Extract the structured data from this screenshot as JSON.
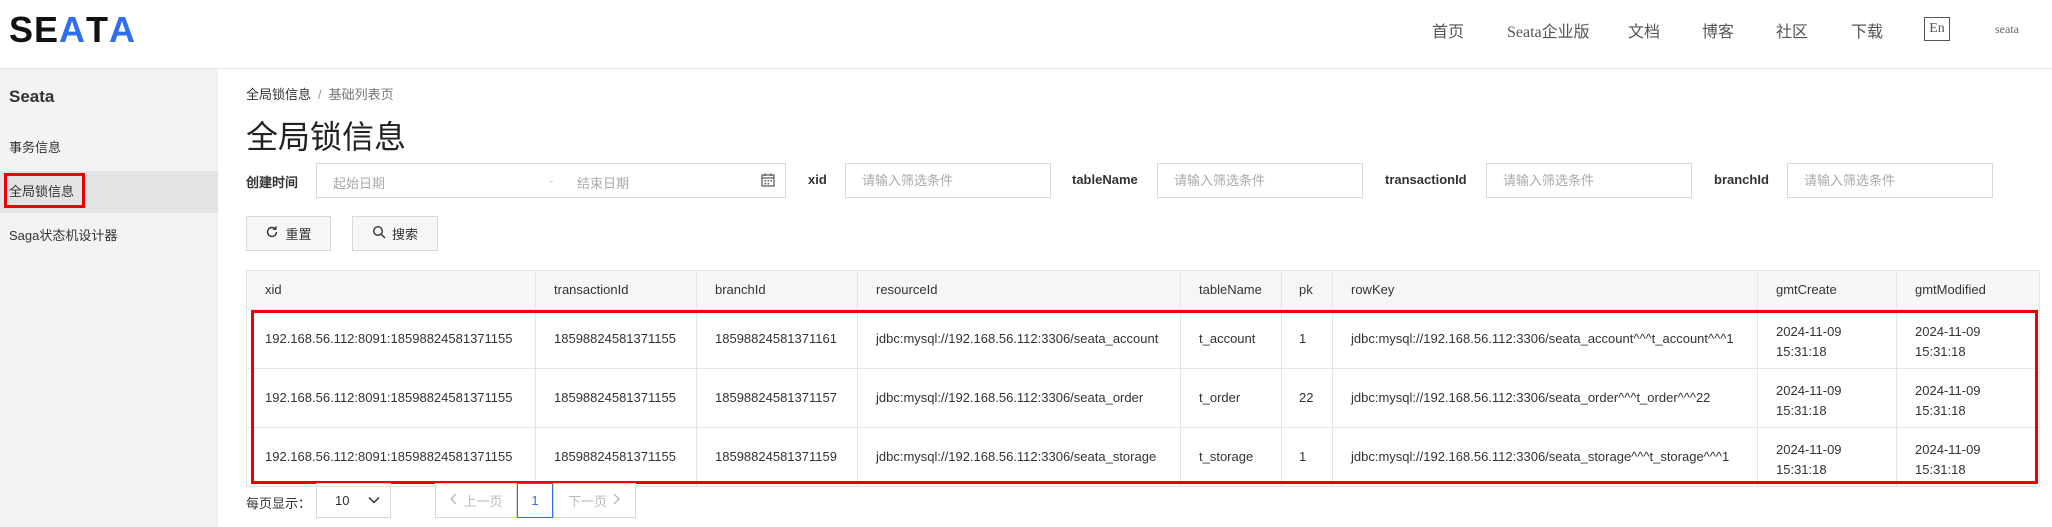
{
  "header": {
    "logo": {
      "s": "S",
      "e": "E",
      "a": "A",
      "t": "T",
      "a2": "A"
    },
    "nav": [
      "首页",
      "Seata企业版",
      "文档",
      "博客",
      "社区",
      "下载"
    ],
    "lang": "En",
    "user": "seata"
  },
  "sidebar": {
    "title": "Seata",
    "items": [
      {
        "label": "事务信息"
      },
      {
        "label": "全局锁信息"
      },
      {
        "label": "Saga状态机设计器"
      }
    ]
  },
  "breadcrumb": {
    "item1": "全局锁信息",
    "sep": "/",
    "item2": "基础列表页"
  },
  "page_title": "全局锁信息",
  "filters": {
    "created_label": "创建时间",
    "start_placeholder": "起始日期",
    "range_sep": "-",
    "end_placeholder": "结束日期",
    "xid_label": "xid",
    "tablename_label": "tableName",
    "transactionid_label": "transactionId",
    "branchid_label": "branchId",
    "input_placeholder": "请输入筛选条件"
  },
  "buttons": {
    "reset": "重置",
    "search": "搜索"
  },
  "table": {
    "columns": [
      "xid",
      "transactionId",
      "branchId",
      "resourceId",
      "tableName",
      "pk",
      "rowKey",
      "gmtCreate",
      "gmtModified"
    ],
    "rows": [
      {
        "xid": "192.168.56.112:8091:18598824581371155",
        "transactionId": "18598824581371155",
        "branchId": "18598824581371161",
        "resourceId": "jdbc:mysql://192.168.56.112:3306/seata_account",
        "tableName": "t_account",
        "pk": "1",
        "rowKey": "jdbc:mysql://192.168.56.112:3306/seata_account^^^t_account^^^1",
        "gmtCreate": [
          "2024-11-09",
          "15:31:18"
        ],
        "gmtModified": [
          "2024-11-09",
          "15:31:18"
        ]
      },
      {
        "xid": "192.168.56.112:8091:18598824581371155",
        "transactionId": "18598824581371155",
        "branchId": "18598824581371157",
        "resourceId": "jdbc:mysql://192.168.56.112:3306/seata_order",
        "tableName": "t_order",
        "pk": "22",
        "rowKey": "jdbc:mysql://192.168.56.112:3306/seata_order^^^t_order^^^22",
        "gmtCreate": [
          "2024-11-09",
          "15:31:18"
        ],
        "gmtModified": [
          "2024-11-09",
          "15:31:18"
        ]
      },
      {
        "xid": "192.168.56.112:8091:18598824581371155",
        "transactionId": "18598824581371155",
        "branchId": "18598824581371159",
        "resourceId": "jdbc:mysql://192.168.56.112:3306/seata_storage",
        "tableName": "t_storage",
        "pk": "1",
        "rowKey": "jdbc:mysql://192.168.56.112:3306/seata_storage^^^t_storage^^^1",
        "gmtCreate": [
          "2024-11-09",
          "15:31:18"
        ],
        "gmtModified": [
          "2024-11-09",
          "15:31:18"
        ]
      }
    ]
  },
  "pagination": {
    "per_page_label": "每页显示：",
    "per_page_value": "10",
    "prev": "上一页",
    "current": "1",
    "next": "下一页"
  },
  "colors": {
    "accent": "#2f6fed",
    "highlight": "#e00000"
  },
  "icons": [
    "calendar-icon",
    "reset-icon",
    "search-icon",
    "chevron-down-icon",
    "chevron-left-icon",
    "chevron-right-icon"
  ]
}
